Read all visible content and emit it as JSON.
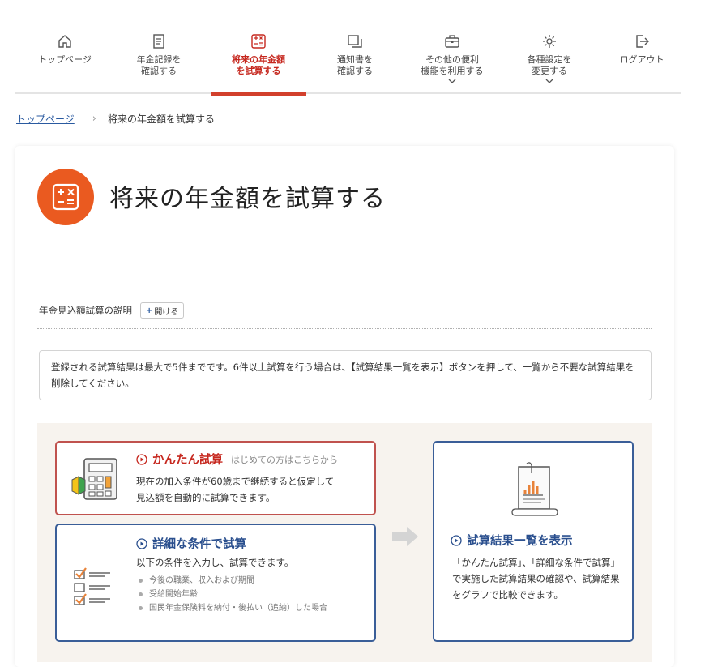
{
  "nav": {
    "items": [
      {
        "label": "トップページ",
        "icon": "home-icon"
      },
      {
        "label": "年金記録を\n確認する",
        "icon": "document-icon"
      },
      {
        "label": "将来の年金額\nを試算する",
        "icon": "calculator-icon",
        "active": true
      },
      {
        "label": "通知書を\n確認する",
        "icon": "copy-icon"
      },
      {
        "label": "その他の便利\n機能を利用する",
        "icon": "toolbox-icon",
        "dropdown": true
      },
      {
        "label": "各種設定を\n変更する",
        "icon": "gear-icon",
        "dropdown": true
      },
      {
        "label": "ログアウト",
        "icon": "logout-icon"
      }
    ]
  },
  "breadcrumb": {
    "home": "トップページ",
    "separator": "›",
    "current": "将来の年金額を試算する"
  },
  "page": {
    "title": "将来の年金額を試算する",
    "explanation_label": "年金見込額試算の説明",
    "expand_plus": "+",
    "expand_label": "開ける",
    "notice": "登録される試算結果は最大で5件までです。6件以上試算を行う場合は、【試算結果一覧を表示】ボタンを押して、一覧から不要な試算結果を削除してください。"
  },
  "options": {
    "easy": {
      "title": "かんたん試算",
      "subtitle": "はじめての方はこちらから",
      "description": "現在の加入条件が60歳まで継続すると仮定して\n見込額を自動的に試算できます。"
    },
    "detail": {
      "title": "詳細な条件で試算",
      "description": "以下の条件を入力し、試算できます。",
      "bullets": [
        "今後の職業、収入および期間",
        "受給開始年齢",
        "国民年金保険料を納付・後払い（追納）した場合"
      ]
    },
    "list": {
      "title": "試算結果一覧を表示",
      "description": "「かんたん試算」、「詳細な条件で試算」で実施した試算結果の確認や、試算結果をグラフで比較できます。"
    }
  },
  "colors": {
    "accent_orange": "#ea5a20",
    "active_red": "#c6281f",
    "link_blue": "#2a5aa0",
    "border_blue": "#3a5e98",
    "border_red": "#c0524e"
  }
}
